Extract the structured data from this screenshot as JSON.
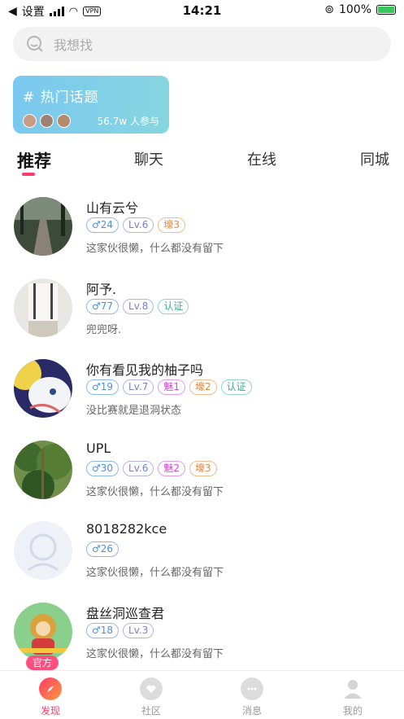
{
  "status_bar": {
    "carrier_label": "设置",
    "vpn": "VPN",
    "time": "14:21",
    "battery": "100%"
  },
  "search": {
    "placeholder": "我想找",
    "icon": "search-chat-icon"
  },
  "topic_card": {
    "title": "# 热门话题",
    "participants": "56.7w 人参与",
    "colors": [
      "#79c8f0",
      "#86d6e0"
    ]
  },
  "tabs": [
    {
      "label": "推荐",
      "active": true
    },
    {
      "label": "聊天",
      "active": false
    },
    {
      "label": "在线",
      "active": false
    },
    {
      "label": "同城",
      "active": false
    }
  ],
  "users": [
    {
      "name": "山有云兮",
      "gender": "♂24",
      "level": "Lv.6",
      "extra": [
        "壕3"
      ],
      "bio": "这家伙很懒，什么都没有留下"
    },
    {
      "name": "阿予.",
      "gender": "♂77",
      "level": "Lv.8",
      "extra": [
        "认证"
      ],
      "bio": "兜兜呀."
    },
    {
      "name": "你有看见我的柚子吗",
      "gender": "♂19",
      "level": "Lv.7",
      "extra": [
        "魅1",
        "壕2",
        "认证"
      ],
      "bio": "没比赛就是退洞状态"
    },
    {
      "name": "UPL",
      "gender": "♂30",
      "level": "Lv.6",
      "extra": [
        "魅2",
        "壕3"
      ],
      "bio": "这家伙很懒，什么都没有留下"
    },
    {
      "name": "8018282kce",
      "gender": "♂26",
      "level": "",
      "extra": [],
      "bio": "这家伙很懒，什么都没有留下"
    },
    {
      "name": "盘丝洞巡查君",
      "gender": "♂18",
      "level": "Lv.3",
      "extra": [],
      "bio": "这家伙很懒，什么都没有留下",
      "official": "官方"
    }
  ],
  "nav": [
    {
      "label": "发现",
      "active": true,
      "icon": "compass-icon"
    },
    {
      "label": "社区",
      "active": false,
      "icon": "heart-bubble-icon"
    },
    {
      "label": "消息",
      "active": false,
      "icon": "chat-dots-icon"
    },
    {
      "label": "我的",
      "active": false,
      "icon": "person-icon"
    }
  ],
  "accent_color": "#ff3b6b"
}
